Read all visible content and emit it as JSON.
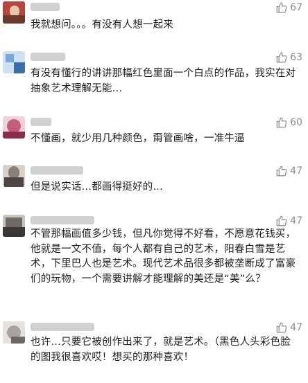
{
  "comments": [
    {
      "likes": "67",
      "text": "我就想问。。。有没有人想一起来",
      "avatar_colors": [
        "#b5463e",
        "#e8c7a8",
        "#6b3b2b"
      ]
    },
    {
      "likes": "63",
      "text": "有没有懂行的讲讲那幅红色里面一个白点的作品，我实在对抽象艺术理解无能…",
      "avatar_colors": [
        "#7aa7d8",
        "#cfe0f1",
        "#3b6ea6"
      ]
    },
    {
      "likes": "60",
      "text": "不懂画，就少用几种颜色，甭管画啥，一准牛逼",
      "avatar_colors": [
        "#c45c7a",
        "#f0d0dc",
        "#8a2f4a"
      ]
    },
    {
      "likes": "47",
      "text": "但是说实话…都画得挺好的…",
      "avatar_colors": [
        "#8a8077",
        "#d8d1ca",
        "#4d4641"
      ]
    },
    {
      "likes": "47",
      "text": "不管那幅画值多少钱，但凡你觉得不好看，不愿意花钱买，他就是一文不值，每个人都有自己的艺术，阳春白雪是艺术，下里巴人也是艺术。现代艺术品很多都被垄断成了富豪们的玩物，一个需要讲解才能理解的美还是“美”么？",
      "avatar_colors": [
        "#6e6a66",
        "#c9c4bf",
        "#3a3735"
      ]
    },
    {
      "likes": "47",
      "text": "也许…只要它被创作出来了，就是艺术。（黑色人头彩色脸的图我很喜欢哎！想买的那种喜欢！",
      "avatar_colors": [
        "#a8a39f",
        "#e4e1de",
        "#6d6864"
      ]
    }
  ],
  "icons": {
    "like": "thumbs-up-icon"
  }
}
